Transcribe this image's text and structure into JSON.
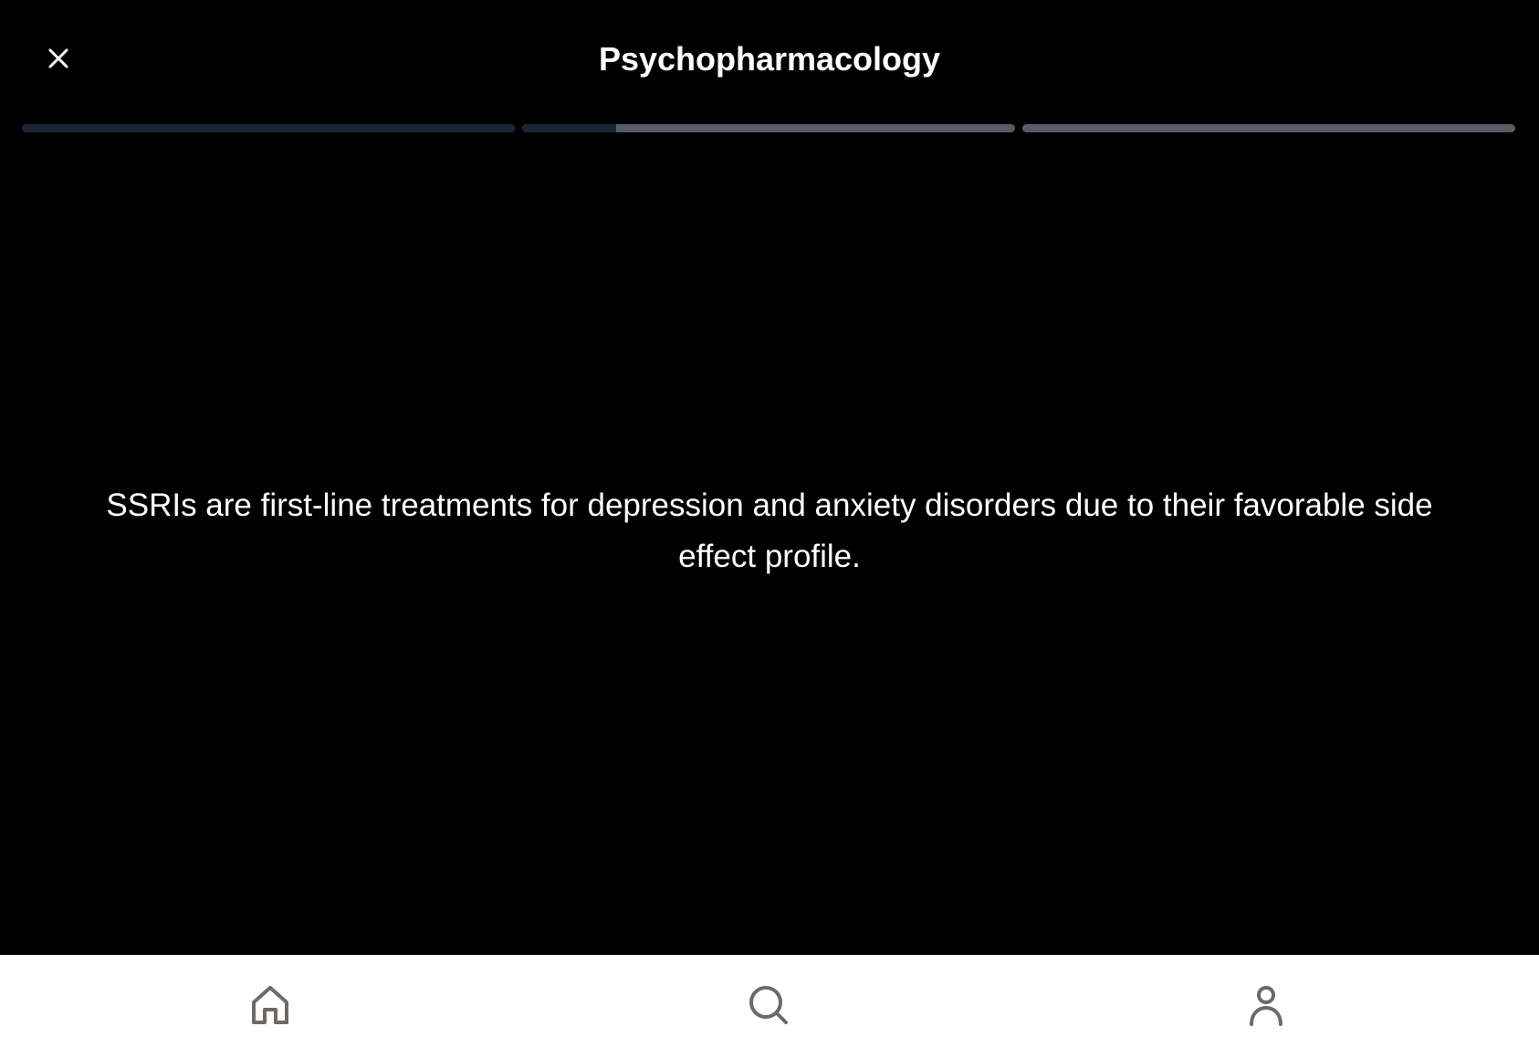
{
  "header": {
    "title": "Psychopharmacology",
    "close_icon": "close-icon"
  },
  "progress": {
    "segments": [
      {
        "fill": 1.0
      },
      {
        "fill": 0.19
      },
      {
        "fill": 0.0
      }
    ],
    "fill_color": "#1a2536",
    "track_color": "#565d66"
  },
  "card": {
    "text": "SSRIs are first-line treatments for depression and anxiety disorders due to their favorable side effect profile."
  },
  "bottom_nav": {
    "items": [
      {
        "icon": "home-icon"
      },
      {
        "icon": "search-icon"
      },
      {
        "icon": "profile-icon"
      }
    ],
    "icon_color": "#6e6a66",
    "background": "#ffffff"
  }
}
